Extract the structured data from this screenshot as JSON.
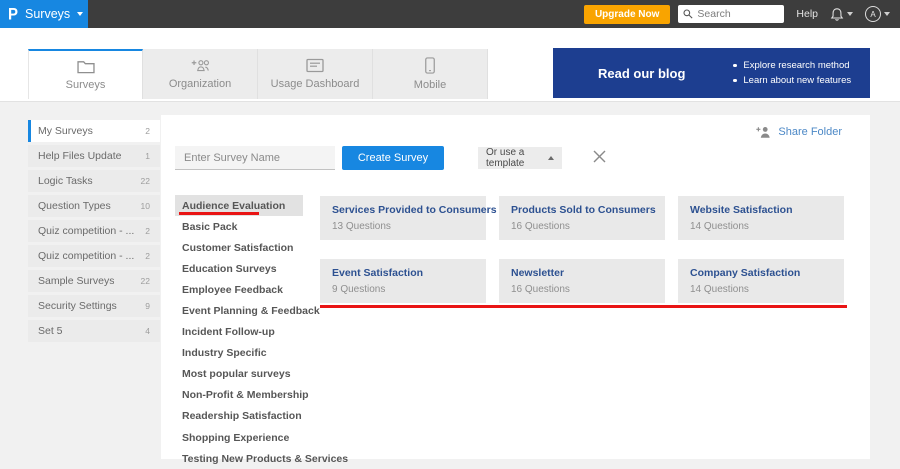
{
  "topbar": {
    "logo_letter": "P",
    "product_name": "Surveys",
    "upgrade_label": "Upgrade Now",
    "search_placeholder": "Search",
    "help_label": "Help",
    "avatar_letter": "A"
  },
  "tabs": [
    {
      "label": "Surveys",
      "active": true
    },
    {
      "label": "Organization",
      "active": false
    },
    {
      "label": "Usage Dashboard",
      "active": false
    },
    {
      "label": "Mobile",
      "active": false
    }
  ],
  "blog": {
    "title": "Read our blog",
    "bullet1": "Explore research method",
    "bullet2": "Learn about new features"
  },
  "sidebar": {
    "items": [
      {
        "label": "My Surveys",
        "count": "2",
        "active": true
      },
      {
        "label": "Help Files Update",
        "count": "1",
        "active": false
      },
      {
        "label": "Logic Tasks",
        "count": "22",
        "active": false
      },
      {
        "label": "Question Types",
        "count": "10",
        "active": false
      },
      {
        "label": "Quiz competition - ...",
        "count": "2",
        "active": false
      },
      {
        "label": "Quiz competition - ...",
        "count": "2",
        "active": false
      },
      {
        "label": "Sample Surveys",
        "count": "22",
        "active": false
      },
      {
        "label": "Security Settings",
        "count": "9",
        "active": false
      },
      {
        "label": "Set 5",
        "count": "4",
        "active": false
      }
    ]
  },
  "main": {
    "share_folder_label": "Share Folder",
    "survey_name_placeholder": "Enter Survey Name",
    "create_button_label": "Create Survey",
    "template_dropdown_label": "Or use a template",
    "selected_category": "Audience Evaluation",
    "categories": [
      "Audience Evaluation",
      "Basic Pack",
      "Customer Satisfaction",
      "Education Surveys",
      "Employee Feedback",
      "Event Planning & Feedback",
      "Incident Follow-up",
      "Industry Specific",
      "Most popular surveys",
      "Non-Profit & Membership",
      "Readership Satisfaction",
      "Shopping Experience",
      "Testing New Products & Services"
    ],
    "templates": [
      {
        "title": "Services Provided to Consumers",
        "questions": "13 Questions"
      },
      {
        "title": "Products Sold to Consumers",
        "questions": "16 Questions"
      },
      {
        "title": "Website Satisfaction",
        "questions": "14 Questions"
      },
      {
        "title": "Event Satisfaction",
        "questions": "9 Questions"
      },
      {
        "title": "Newsletter",
        "questions": "16 Questions"
      },
      {
        "title": "Company Satisfaction",
        "questions": "14 Questions"
      }
    ]
  },
  "colors": {
    "accent_blue": "#1787e1",
    "navy_panel": "#1d3e90",
    "upgrade_orange": "#f9a400",
    "link_blue": "#4c88c6",
    "card_title_blue": "#2d5191",
    "annotation_red": "#e91414",
    "topbar_dark": "#3d3d3d"
  }
}
